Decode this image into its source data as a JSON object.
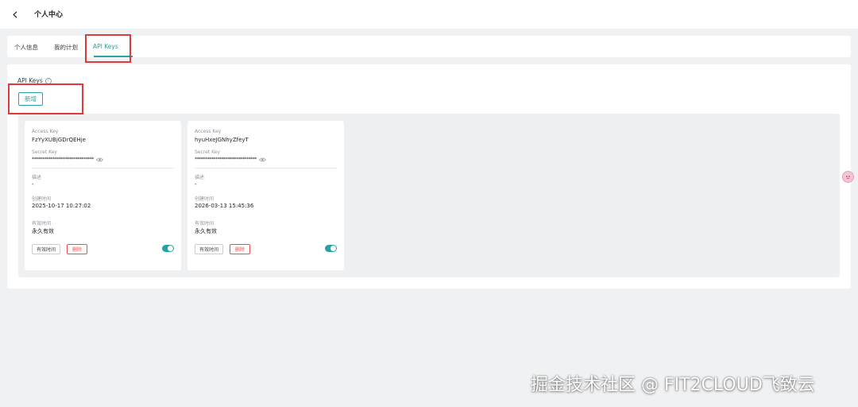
{
  "header": {
    "title": "个人中心",
    "back_icon": "chevron-left-icon"
  },
  "tabs": [
    {
      "label": "个人信息",
      "active": false
    },
    {
      "label": "我的计划",
      "active": false
    },
    {
      "label": "API Keys",
      "active": true
    }
  ],
  "section": {
    "title": "API Keys",
    "help_icon": "question-circle-icon",
    "help_glyph": "?"
  },
  "new_button_label": "新增",
  "cards": [
    {
      "access_key_label": "Access Key",
      "access_key": "FzYyXUBjGDrQEHje",
      "secret_key_label": "Secret Key",
      "secret_key": "******************************",
      "description_label": "描述",
      "description": "-",
      "created_label": "创建时间",
      "created": "2025-10-17 10:27:02",
      "valid_label": "有效时间",
      "valid": "永久有效",
      "period_button": "有效时间",
      "delete_button": "删除",
      "enabled": true
    },
    {
      "access_key_label": "Access Key",
      "access_key": "hyuHxeJGNhyZfeyT",
      "secret_key_label": "Secret Key",
      "secret_key": "******************************",
      "description_label": "描述",
      "description": "-",
      "created_label": "创建时间",
      "created": "2026-03-13 15:45:36",
      "valid_label": "有效时间",
      "valid": "永久有效",
      "period_button": "有效时间",
      "delete_button": "删除",
      "enabled": true
    }
  ],
  "watermark": "掘金技术社区 @ FIT2CLOUD飞致云",
  "colors": {
    "accent": "#2aa1a4",
    "danger": "#f54a45",
    "highlight_box": "#e0393b",
    "background": "#f0f1f2"
  }
}
